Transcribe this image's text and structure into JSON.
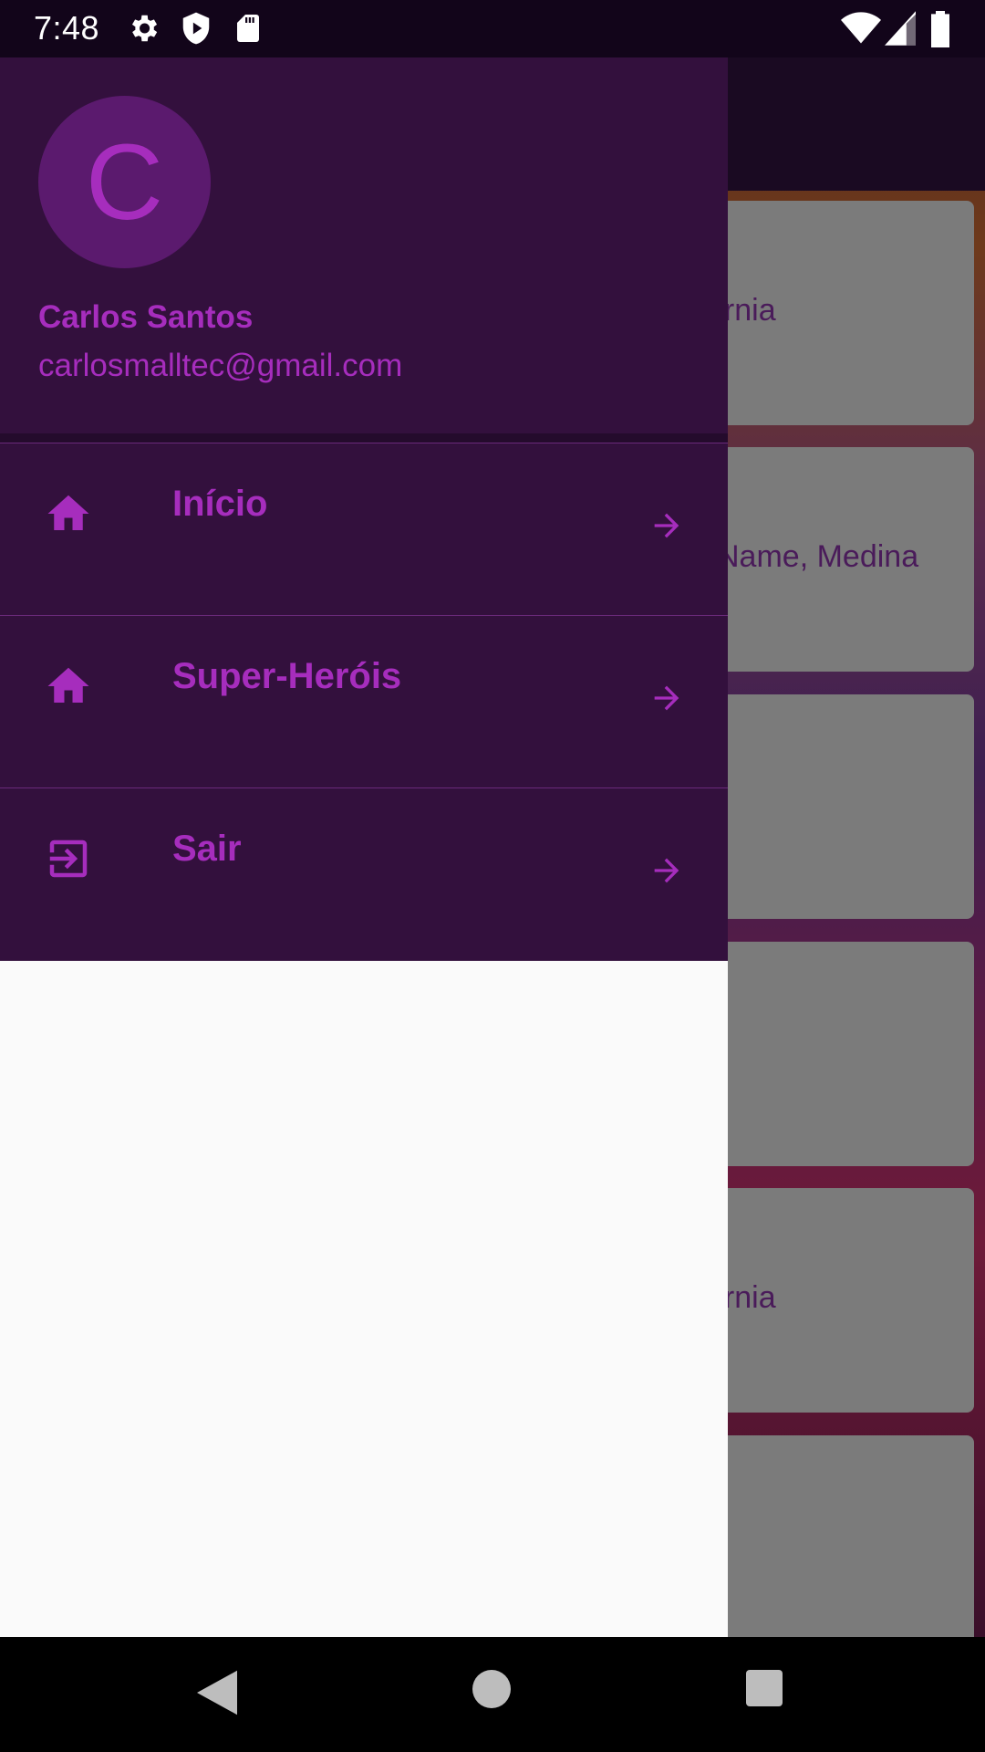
{
  "status_bar": {
    "time": "7:48",
    "icons": [
      "gear-icon",
      "shield-play-icon",
      "sd-card-icon",
      "wifi-icon",
      "signal-icon",
      "battery-icon"
    ]
  },
  "background_cards": [
    {
      "text": "ornia"
    },
    {
      "text": "Name, Medina"
    },
    {
      "text": ""
    },
    {
      "text": ""
    },
    {
      "text": "ornia"
    },
    {
      "text": ""
    }
  ],
  "drawer": {
    "avatar_letter": "C",
    "account_name": "Carlos Santos",
    "account_email": "carlosmalltec@gmail.com",
    "items": [
      {
        "label": "Início",
        "icon": "home-icon"
      },
      {
        "label": "Super-Heróis",
        "icon": "home-icon"
      },
      {
        "label": "Sair",
        "icon": "exit-icon"
      }
    ]
  },
  "nav_bar": {
    "buttons": [
      "back-icon",
      "home-circle-icon",
      "recents-icon"
    ]
  },
  "colors": {
    "accent": "#a62dbd",
    "header_bg": "#33103d",
    "drawer_bg": "#fafafa",
    "status_bg": "#12051a"
  }
}
